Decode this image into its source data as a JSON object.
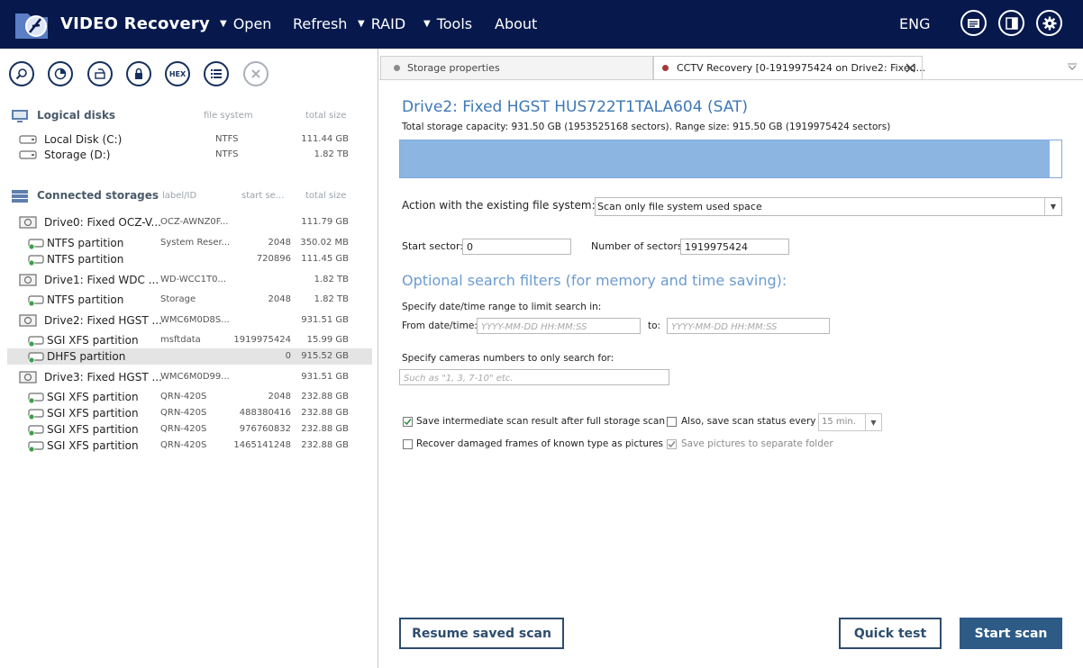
{
  "app": {
    "title": "VIDEO Recovery",
    "language": "ENG"
  },
  "menu": [
    {
      "label": "Open",
      "has_arrow": true
    },
    {
      "label": "Refresh",
      "has_arrow": false
    },
    {
      "label": "RAID",
      "has_arrow": true
    },
    {
      "label": "Tools",
      "has_arrow": true
    },
    {
      "label": "About",
      "has_arrow": false
    }
  ],
  "toolbar": {
    "hex_label": "HEX"
  },
  "logical_disks": {
    "title": "Logical disks",
    "col_fs": "file system",
    "col_size": "total size",
    "items": [
      {
        "name": "Local Disk (C:)",
        "fs": "NTFS",
        "size": "111.44 GB"
      },
      {
        "name": "Storage (D:)",
        "fs": "NTFS",
        "size": "1.82 TB"
      }
    ]
  },
  "connected": {
    "title": "Connected storages",
    "col_label": "label/ID",
    "col_start": "start se...",
    "col_size": "total size",
    "rows": [
      {
        "kind": "drive",
        "name": "Drive0: Fixed OCZ-V...",
        "label": "OCZ-AWNZ0F...",
        "start": "",
        "size": "111.79 GB"
      },
      {
        "kind": "part",
        "name": "NTFS partition",
        "label": "System Reser...",
        "start": "2048",
        "size": "350.02 MB"
      },
      {
        "kind": "part",
        "name": "NTFS partition",
        "label": "",
        "start": "720896",
        "size": "111.45 GB"
      },
      {
        "kind": "drive",
        "name": "Drive1: Fixed WDC ...",
        "label": "WD-WCC1T0...",
        "start": "",
        "size": "1.82 TB"
      },
      {
        "kind": "part",
        "name": "NTFS partition",
        "label": "Storage",
        "start": "2048",
        "size": "1.82 TB"
      },
      {
        "kind": "drive",
        "name": "Drive2: Fixed HGST ...",
        "label": "WMC6M0D8S...",
        "start": "",
        "size": "931.51 GB"
      },
      {
        "kind": "part",
        "name": "SGI XFS partition",
        "label": "msftdata",
        "start": "1919975424",
        "size": "15.99 GB"
      },
      {
        "kind": "part",
        "name": "DHFS partition",
        "label": "",
        "start": "0",
        "size": "915.52 GB",
        "selected": true
      },
      {
        "kind": "drive",
        "name": "Drive3: Fixed HGST ...",
        "label": "WMC6M0D99...",
        "start": "",
        "size": "931.51 GB"
      },
      {
        "kind": "part",
        "name": "SGI XFS partition",
        "label": "QRN-420S",
        "start": "2048",
        "size": "232.88 GB"
      },
      {
        "kind": "part",
        "name": "SGI XFS partition",
        "label": "QRN-420S",
        "start": "488380416",
        "size": "232.88 GB"
      },
      {
        "kind": "part",
        "name": "SGI XFS partition",
        "label": "QRN-420S",
        "start": "976760832",
        "size": "232.88 GB"
      },
      {
        "kind": "part",
        "name": "SGI XFS partition",
        "label": "QRN-420S",
        "start": "1465141248",
        "size": "232.88 GB"
      }
    ]
  },
  "tabs": [
    {
      "label": "Storage properties",
      "dot_color": "#8a8a8a",
      "active": false
    },
    {
      "label": "CCTV Recovery [0-1919975424 on Drive2: Fixed...",
      "dot_color": "#a33b3b",
      "active": true
    }
  ],
  "main": {
    "drive_title": "Drive2: Fixed HGST HUS722T1TALA604 (SAT)",
    "capacity_text": "Total storage capacity: 931.50 GB (1953525168 sectors). Range size: 915.50 GB (1919975424 sectors)",
    "range_fraction": 0.982,
    "action_label": "Action with the existing file system:",
    "action_value": "Scan only file system used space",
    "start_sector_label": "Start sector:",
    "start_sector_value": "0",
    "num_sectors_label": "Number of sectors:",
    "num_sectors_value": "1919975424",
    "optional_title": "Optional search filters (for memory and time saving):",
    "date_range_label": "Specify date/time range to limit search in:",
    "from_label": "From date/time:",
    "date_placeholder": "YYYY-MM-DD HH:MM:SS",
    "to_label": "to:",
    "cameras_label": "Specify cameras numbers to only search for:",
    "cameras_placeholder": "Such as \"1, 3, 7-10\" etc.",
    "save_intermediate_label": "Save intermediate scan result after full storage scan",
    "save_intermediate_checked": true,
    "save_status_label": "Also, save scan status every",
    "save_status_checked": false,
    "interval_value": "15 min.",
    "recover_damaged_label": "Recover damaged frames of known type as pictures",
    "recover_damaged_checked": false,
    "save_pictures_label": "Save pictures to separate folder",
    "save_pictures_checked": true,
    "resume_button": "Resume saved scan",
    "quick_test_button": "Quick test",
    "start_scan_button": "Start scan"
  },
  "colors": {
    "header_bg": "#06184c",
    "accent": "#3d78b7",
    "range_fill": "#8db5e2",
    "primary_button": "#2d5b86"
  }
}
